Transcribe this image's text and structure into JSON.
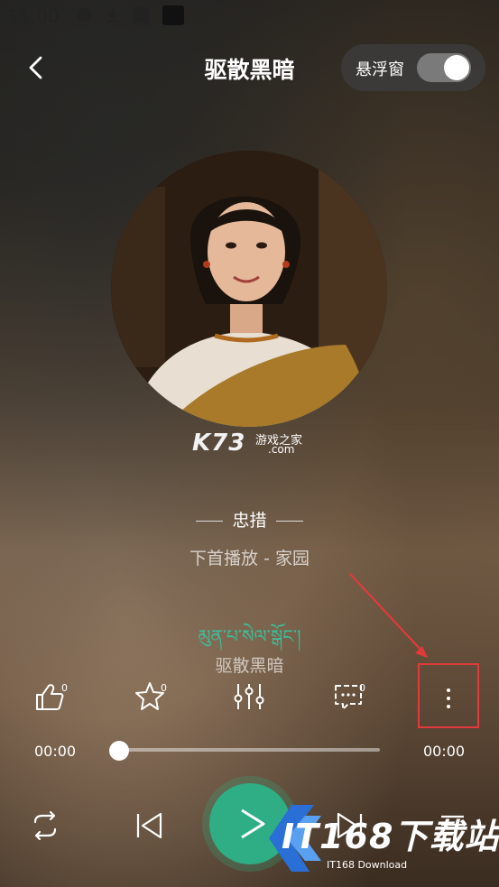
{
  "status_bar": {
    "time": "11:00"
  },
  "header": {
    "title": "驱散黑暗",
    "float_window_label": "悬浮窗",
    "float_window_on": true
  },
  "cover_watermark": {
    "brand": "K73",
    "tagline": "游戏之家",
    "domain": ".com"
  },
  "song": {
    "singer": "忠措",
    "next_up": "下首播放 - 家园",
    "lyric_tibetan": "མུན་པ་སེལ་སྒོང་།",
    "lyric_chinese": "驱散黑暗"
  },
  "actions": [
    {
      "name": "like",
      "count": "0"
    },
    {
      "name": "favorite",
      "count": "0"
    },
    {
      "name": "equalizer"
    },
    {
      "name": "comment",
      "count": "0"
    },
    {
      "name": "more"
    }
  ],
  "progress": {
    "current": "00:00",
    "total": "00:00",
    "fraction": 0
  },
  "site_watermark": {
    "text": "IT168下载站",
    "sub": "IT168 Download"
  },
  "colors": {
    "accent": "#2fae85",
    "highlight": "#e23a3a",
    "lyric": "#3dbf9a"
  }
}
